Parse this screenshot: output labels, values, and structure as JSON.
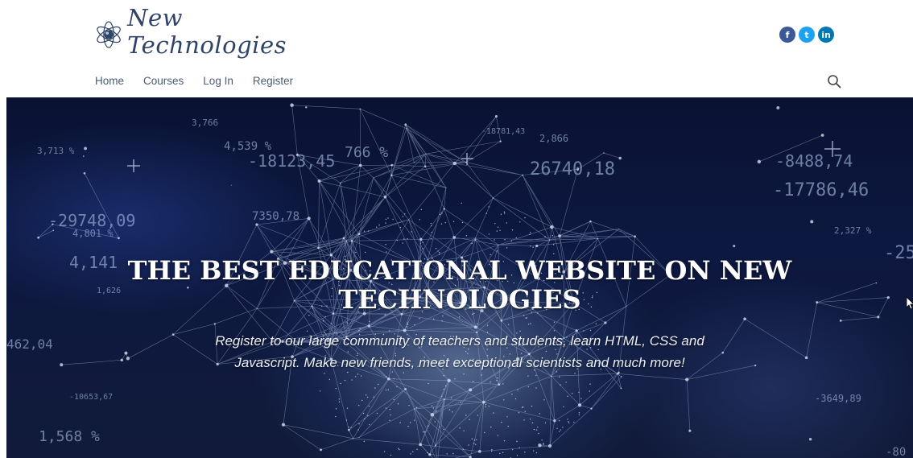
{
  "header": {
    "logo_text": "New Technologies",
    "social": [
      {
        "icon": "facebook-icon",
        "glyph": "f",
        "color": "#3b5998"
      },
      {
        "icon": "twitter-icon",
        "glyph": "t",
        "color": "#1da1f2"
      },
      {
        "icon": "linkedin-icon",
        "glyph": "in",
        "color": "#0077b5"
      }
    ]
  },
  "nav": {
    "items": [
      "Home",
      "Courses",
      "Log In",
      "Register"
    ]
  },
  "hero": {
    "title_line1": "THE BEST EDUCATIONAL WEBSITE ON NEW",
    "title_line2": "TECHNOLOGIES",
    "subtitle_line1": "Register to our large community of teachers and students, learn HTML, CSS and",
    "subtitle_line2": "Javascript. Make new friends, meet exceptional scientists and much more!",
    "background_numbers": [
      "3,713 %",
      "-29748,09",
      "4,801 %",
      "4,141",
      "1,626",
      "462,04",
      "-10653,67",
      "1,568 %",
      "3,766",
      "4,539 %",
      "-18123,45",
      "766 %",
      "7350,78",
      "-18781,43",
      "2,866",
      "26740,18",
      "-8488,74",
      "-17786,46",
      "2,327 %",
      "-25",
      "-3649,89",
      "-80"
    ]
  },
  "colors": {
    "brand": "#2f4468",
    "nav_text": "#4a5b74",
    "hero_bg": "#0d1840"
  }
}
